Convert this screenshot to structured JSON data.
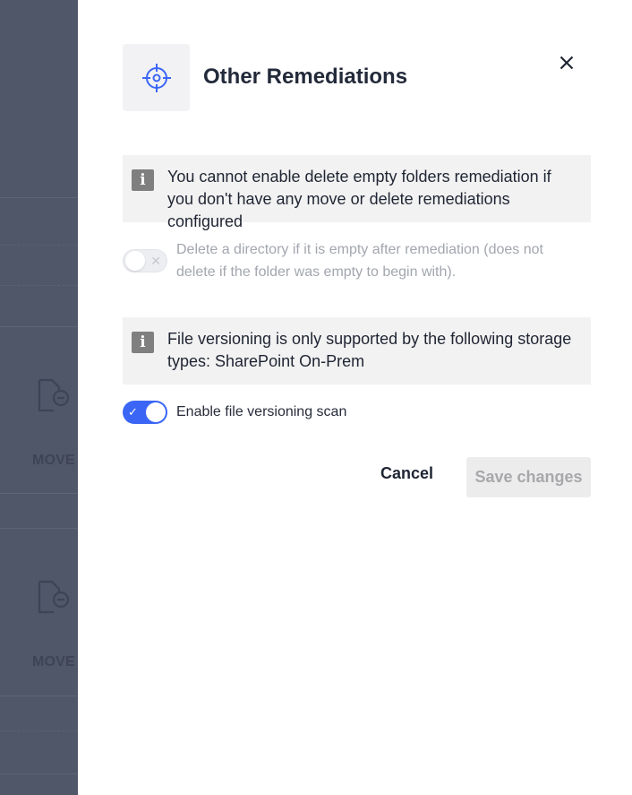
{
  "background": {
    "move_labels": [
      "MOVE",
      "MOVE"
    ]
  },
  "drawer": {
    "title": "Other Remediations",
    "header_icon": "crosshair-target-icon",
    "close_icon": "close-icon",
    "notice_empty_folders": "You cannot enable delete empty folders remediation if you don't have any move or delete remediations configured",
    "delete_empty_dirs_toggle": {
      "label": "Delete a directory if it is empty after remediation (does not delete if the folder was empty to begin with).",
      "state": "off",
      "disabled": true
    },
    "notice_versioning": "File versioning is only supported by the following storage types: SharePoint On-Prem",
    "versioning_toggle": {
      "label": "Enable file versioning scan",
      "state": "on",
      "disabled": false
    },
    "info_icon_glyph": "i",
    "cancel_label": "Cancel",
    "save_label": "Save changes"
  },
  "colors": {
    "accent": "#3b66f5",
    "backdrop": "#4f5769",
    "title": "#232a3a"
  }
}
